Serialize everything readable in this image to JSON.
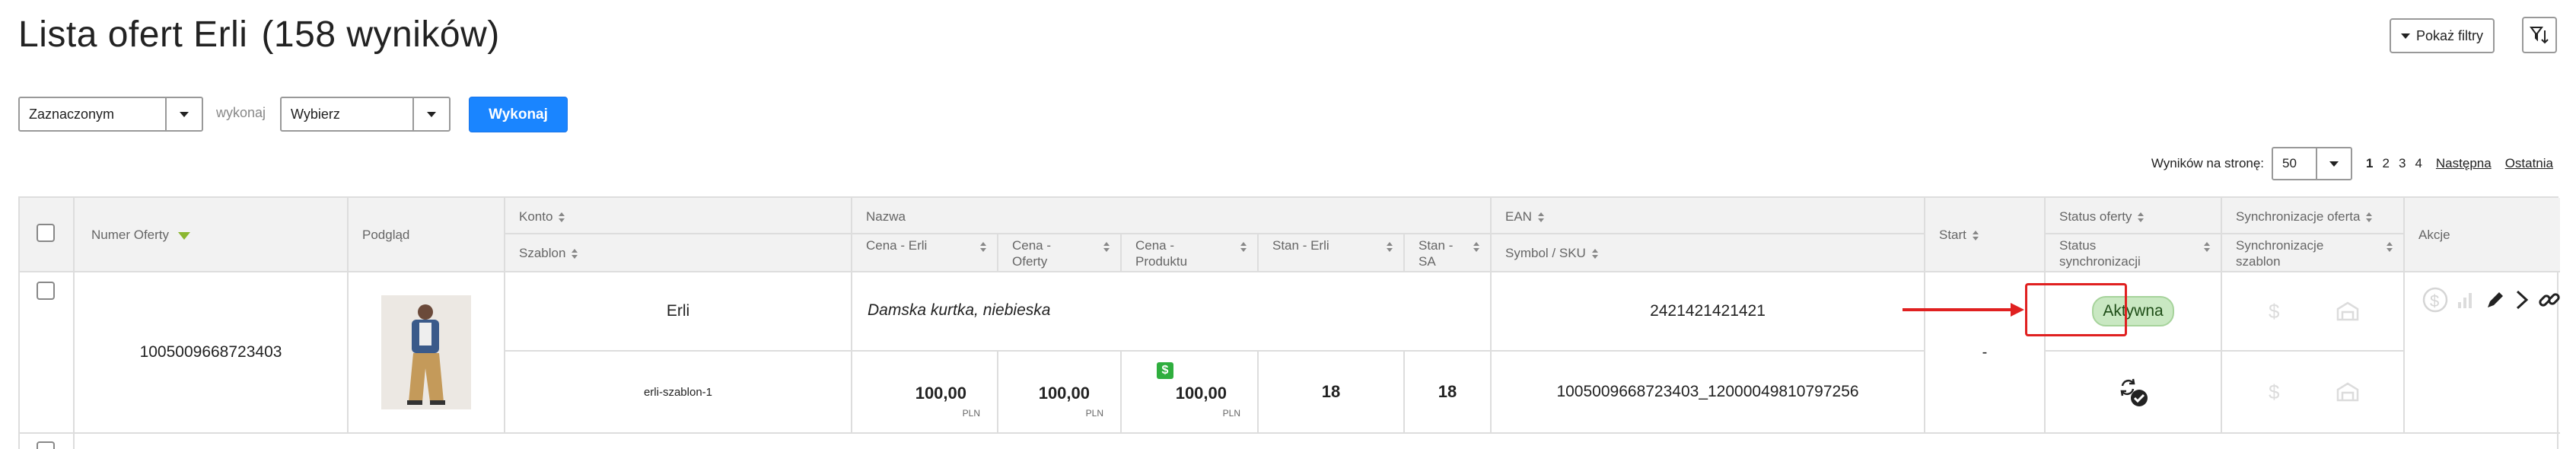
{
  "page": {
    "title": "Lista ofert Erli",
    "result_count": "(158 wyników)"
  },
  "toolbar": {
    "filters_button": "Pokaż filtry",
    "scope_select": "Zaznaczonym",
    "execute_label": "wykonaj",
    "action_select": "Wybierz",
    "execute_button": "Wykonaj"
  },
  "pagination": {
    "per_page_label": "Wyników na stronę:",
    "per_page_value": "50",
    "pages": [
      "1",
      "2",
      "3",
      "4"
    ],
    "current_page": "1",
    "next": "Następna",
    "last": "Ostatnia"
  },
  "table": {
    "headers": {
      "offer_number": "Numer Oferty",
      "preview": "Podgląd",
      "account": "Konto",
      "template": "Szablon",
      "name": "Nazwa",
      "price_erli": "Cena - Erli",
      "price_offer": "Cena - Oferty",
      "price_product": "Cena - Produktu",
      "stock_erli": "Stan - Erli",
      "stock_sa": "Stan - SA",
      "ean": "EAN",
      "symbol_sku": "Symbol / SKU",
      "start": "Start",
      "offer_status": "Status oferty",
      "sync_status": "Status synchronizacji",
      "sync_offer": "Synchronizacje oferta",
      "sync_template": "Synchronizacje szablon",
      "actions": "Akcje"
    },
    "rows": [
      {
        "offer_number": "1005009668723403",
        "account": "Erli",
        "template": "erli-szablon-1",
        "name": "Damska kurtka, niebieska",
        "price_erli": "100,00",
        "price_offer": "100,00",
        "price_product": "100,00",
        "currency": "PLN",
        "stock_erli": "18",
        "stock_sa": "18",
        "ean": "2421421421421",
        "symbol_sku": "1005009668723403_12000049810797256",
        "start": "-",
        "offer_status": "Aktywna"
      }
    ]
  },
  "colors": {
    "accent": "#1a85ff",
    "status_active_bg": "#c9e8c2",
    "annotation": "#e02020",
    "header_bg": "#f2f2f2"
  }
}
